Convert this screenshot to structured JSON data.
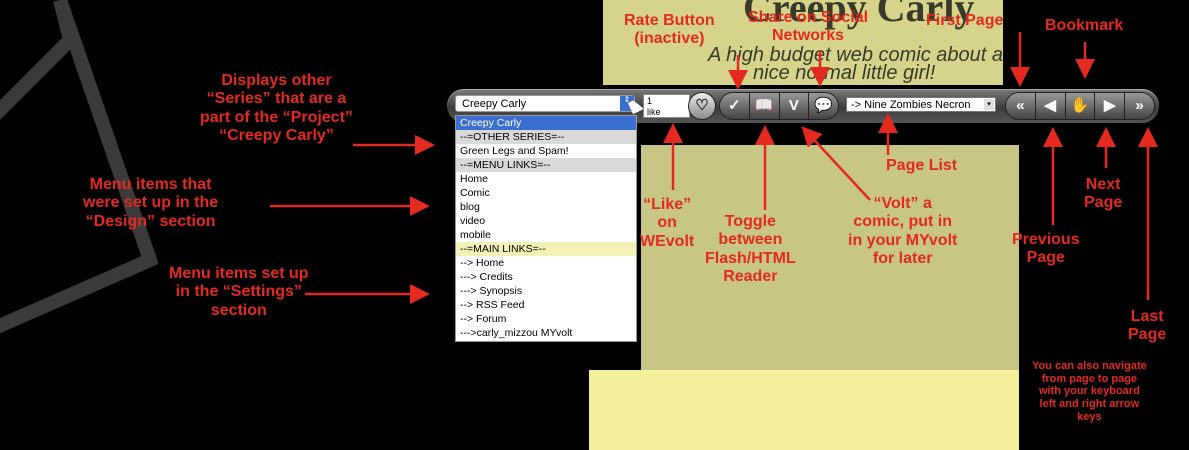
{
  "comic": {
    "title": "Creepy Carly",
    "tagline_1": "A high budget web comic about a",
    "tagline_2": "nice normal little girl!"
  },
  "toolbar": {
    "series_select": {
      "value": "Creepy Carly",
      "arrow": "⇕"
    },
    "like_count": "1",
    "like_label": "like",
    "heart_icon": "♡",
    "rate_icon": "✓",
    "toggle_icon": "📖",
    "volt_icon": "V",
    "share_icon": "💬",
    "page_select": {
      "value": "-> Nine Zombies Necron",
      "arrow": "▾"
    },
    "nav": {
      "first": "«",
      "prev": "◀",
      "bookmark": "✋",
      "next": "▶",
      "last": "»"
    }
  },
  "dropdown": {
    "items": [
      {
        "label": "Creepy Carly",
        "kind": "selected"
      },
      {
        "label": "--=OTHER SERIES=--",
        "kind": "header"
      },
      {
        "label": "Green Legs and Spam!",
        "kind": "item"
      },
      {
        "label": "--=MENU LINKS=--",
        "kind": "header"
      },
      {
        "label": "Home",
        "kind": "item"
      },
      {
        "label": "Comic",
        "kind": "item"
      },
      {
        "label": "blog",
        "kind": "item"
      },
      {
        "label": "video",
        "kind": "item"
      },
      {
        "label": "mobile",
        "kind": "item"
      },
      {
        "label": "--=MAIN LINKS=--",
        "kind": "header2"
      },
      {
        "label": "--> Home",
        "kind": "item"
      },
      {
        "label": "---> Credits",
        "kind": "item"
      },
      {
        "label": "---> Synopsis",
        "kind": "item"
      },
      {
        "label": "--> RSS Feed",
        "kind": "item"
      },
      {
        "label": "--> Forum",
        "kind": "item"
      },
      {
        "label": "--->carly_mizzou MYvolt",
        "kind": "item"
      }
    ]
  },
  "annotations": {
    "series": [
      "Displays other",
      "“Series” that are a",
      "part of the “Project”",
      "“Creepy Carly”"
    ],
    "design": [
      "Menu items that",
      "were set up in the",
      "“Design” section"
    ],
    "settings": [
      "Menu items set up",
      "in the “Settings”",
      "section"
    ],
    "rate": [
      "Rate Button",
      "(inactive)"
    ],
    "share": [
      "Share on Social",
      "Networks"
    ],
    "first": [
      "First Page"
    ],
    "bookmark": [
      "Bookmark"
    ],
    "page_list": [
      "Page List"
    ],
    "like": [
      "“Like”",
      "on",
      "WEvolt"
    ],
    "toggle": [
      "Toggle",
      "between",
      "Flash/HTML",
      "Reader"
    ],
    "volt": [
      "“Volt” a",
      "comic, put in",
      "in your MYvolt",
      "for later"
    ],
    "next": [
      "Next",
      "Page"
    ],
    "previous": [
      "Previous",
      "Page"
    ],
    "last": [
      "Last",
      "Page"
    ],
    "keyboard": [
      "You can also navigate",
      "from page to page",
      "with your keyboard",
      "left and right arrow",
      "keys"
    ]
  },
  "colors": {
    "annotation": "#e42920",
    "selection": "#3b6fd1",
    "comic_paper": "#f2f09a"
  }
}
